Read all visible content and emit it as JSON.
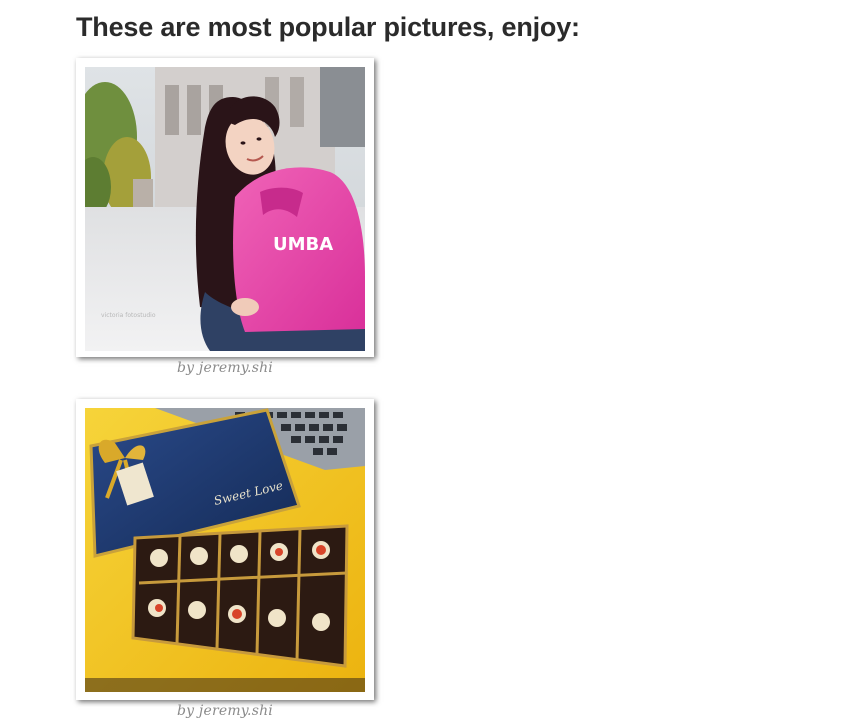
{
  "heading": "These are most popular pictures, enjoy:",
  "photos": [
    {
      "caption": "by jeremy.shi",
      "subject": "girl in pink hoodie",
      "hoodie_text": "UMBA",
      "watermark": "victoria fotostudio"
    },
    {
      "caption": "by jeremy.shi",
      "subject": "chocolate gift box",
      "box_text": "Sweet Love"
    }
  ],
  "colors": {
    "heading": "#2b2b2b",
    "caption": "#8a8a8a",
    "hoodie": "#e63fa5",
    "box_lid": "#1f3a6e",
    "background_yellow": "#f3c51a"
  }
}
